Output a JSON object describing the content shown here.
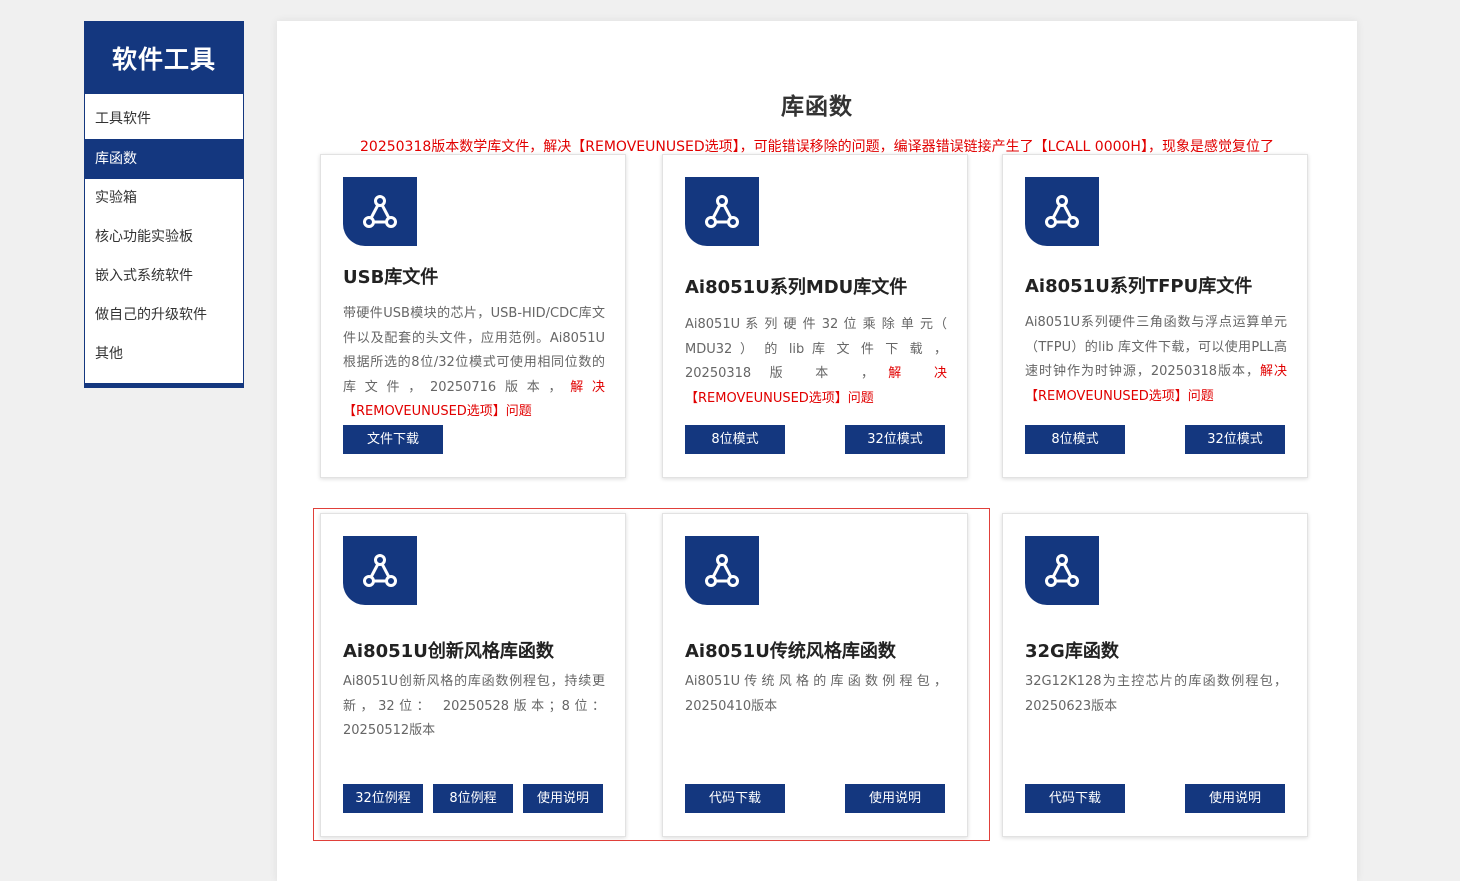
{
  "sidebar": {
    "title": "软件工具",
    "items": [
      {
        "label": "工具软件"
      },
      {
        "label": "库函数"
      },
      {
        "label": "实验箱"
      },
      {
        "label": "核心功能实验板"
      },
      {
        "label": "嵌入式系统软件"
      },
      {
        "label": "做自己的升级软件"
      },
      {
        "label": "其他"
      }
    ],
    "active_index": 1
  },
  "main": {
    "title": "库函数",
    "notice": "20250318版本数学库文件，解决【REMOVEUNUSED选项】，可能错误移除的问题，编译器错误链接产生了【LCALL  0000H】，现象是感觉复位了"
  },
  "cards": [
    {
      "title": "USB库文件",
      "desc": "带硬件USB模块的芯片，USB-HID/CDC库文件以及配套的头文件，应用范例。Ai8051U根据所选的8位/32位模式可使用相同位数的库文件，20250716版本，",
      "desc_red": "解决【REMOVEUNUSED选项】问题",
      "buttons": [
        "文件下载"
      ]
    },
    {
      "title": "Ai8051U系列MDU库文件",
      "desc": "Ai8051U 系 列 硬 件 32 位 乘 除 单 元（ MDU32 ） 的 lib 库 文 件 下 载 ， 20250318 版 本 ，",
      "desc_red": "解 决【REMOVEUNUSED选项】问题",
      "buttons": [
        "8位模式",
        "32位模式"
      ]
    },
    {
      "title": "Ai8051U系列TFPU库文件",
      "desc": "Ai8051U系列硬件三角函数与浮点运算单元（TFPU）的lib 库文件下载，可以使用PLL高速时钟作为时钟源，20250318版本，",
      "desc_red": "解决【REMOVEUNUSED选项】问题",
      "buttons": [
        "8位模式",
        "32位模式"
      ]
    },
    {
      "title": "Ai8051U创新风格库函数",
      "desc": "Ai8051U创新风格的库函数例程包，持续更新，32位： 20250528版本；8位：20250512版本",
      "desc_red": "",
      "buttons": [
        "32位例程",
        "8位例程",
        "使用说明"
      ]
    },
    {
      "title": "Ai8051U传统风格库函数",
      "desc": "Ai8051U 传 统 风 格 的 库 函 数 例 程 包 ，20250410版本",
      "desc_red": "",
      "buttons": [
        "代码下载",
        "使用说明"
      ]
    },
    {
      "title": "32G库函数",
      "desc": "32G12K128为主控芯片的库函数例程包，20250623版本",
      "desc_red": "",
      "buttons": [
        "代码下载",
        "使用说明"
      ]
    }
  ],
  "colors": {
    "brand": "#14377f",
    "notice": "#e10000",
    "highlight": "#e0403a"
  },
  "icons": {
    "card": "share-network-icon"
  }
}
